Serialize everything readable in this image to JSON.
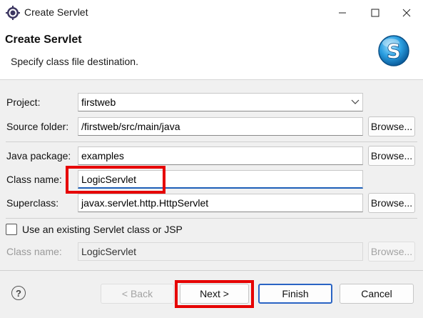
{
  "window": {
    "title": "Create Servlet"
  },
  "header": {
    "title": "Create Servlet",
    "description": "Specify class file destination."
  },
  "form": {
    "project": {
      "label": "Project:",
      "value": "firstweb"
    },
    "source_folder": {
      "label": "Source folder:",
      "value": "/firstweb/src/main/java",
      "browse": "Browse..."
    },
    "java_package": {
      "label": "Java package:",
      "value": "examples",
      "browse": "Browse..."
    },
    "class_name": {
      "label": "Class name:",
      "value": "LogicServlet"
    },
    "superclass": {
      "label": "Superclass:",
      "value": "javax.servlet.http.HttpServlet",
      "browse": "Browse..."
    },
    "use_existing": {
      "label": "Use an existing Servlet class or JSP",
      "checked": false
    },
    "existing_class_name": {
      "label": "Class name:",
      "value": "LogicServlet",
      "browse": "Browse..."
    }
  },
  "footer": {
    "back": "< Back",
    "next": "Next >",
    "finish": "Finish",
    "cancel": "Cancel",
    "help": "?"
  },
  "colors": {
    "highlight": "#e60000",
    "focus": "#1d5fb8"
  }
}
